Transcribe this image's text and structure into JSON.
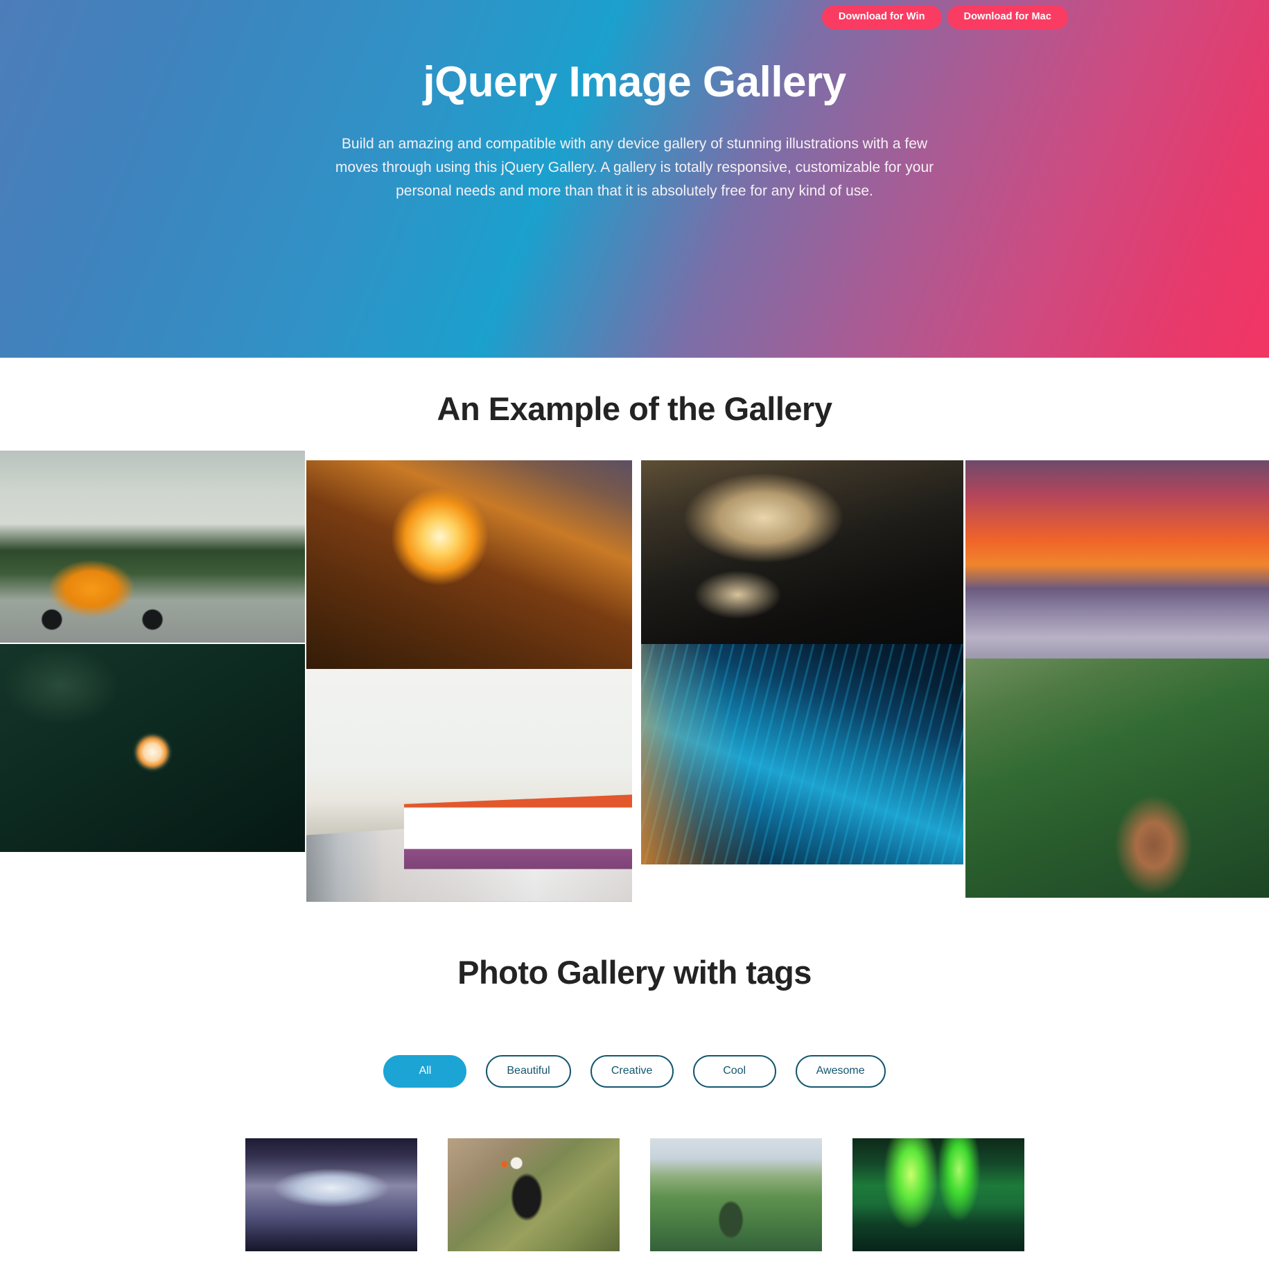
{
  "hero": {
    "buttons": [
      {
        "label": "Download for Win",
        "name": "download-win-button"
      },
      {
        "label": "Download for Mac",
        "name": "download-mac-button"
      }
    ],
    "title": "jQuery Image Gallery",
    "subtitle": "Build an amazing and compatible with any device gallery of stunning illustrations with a few moves through using this jQuery Gallery. A gallery is totally responsive, customizable for your personal needs and more than that it is absolutely free for any kind of use.",
    "colors": {
      "gradient_start": "#4d7dba",
      "gradient_mid": "#1ba0cd",
      "gradient_end": "#f23563",
      "button_bg": "#fa3c63",
      "text": "#ffffff"
    }
  },
  "gallery_section": {
    "heading": "An Example of the Gallery",
    "images": [
      {
        "caption": "Orange vintage car parked by a modern building",
        "art": "a-car"
      },
      {
        "caption": "Sunrise over a forested mountain valley",
        "art": "a-sunset-mtn"
      },
      {
        "caption": "Dark storm clouds at dusk",
        "art": "a-storm"
      },
      {
        "caption": "Red sunset above a sea of fog and mountains",
        "art": "a-fog-sunset"
      },
      {
        "caption": "White and orange rose with dew on dark leaves",
        "art": "a-rose"
      },
      {
        "caption": "Row of city transit buses at a depot",
        "art": "a-bus"
      },
      {
        "caption": "Aerial night view of an illuminated coastal city",
        "art": "a-city"
      },
      {
        "caption": "Green mountain ridge with a winding river",
        "art": "a-green-mtn"
      }
    ]
  },
  "tags_section": {
    "heading": "Photo Gallery with tags",
    "tags": [
      {
        "label": "All",
        "active": true
      },
      {
        "label": "Beautiful",
        "active": false
      },
      {
        "label": "Creative",
        "active": false
      },
      {
        "label": "Cool",
        "active": false
      },
      {
        "label": "Awesome",
        "active": false
      }
    ],
    "colors": {
      "active_bg": "#1ca4d4",
      "border": "#13566e",
      "text": "#13566e"
    },
    "thumbnails": [
      {
        "caption": "Snowy mountain valley at dusk",
        "art": "a-yosemite"
      },
      {
        "caption": "Puffin standing among wildflowers on a cliff",
        "art": "a-puffin"
      },
      {
        "caption": "Hiker walking a green ridge trail",
        "art": "a-hiker"
      },
      {
        "caption": "Green aurora borealis over a lake",
        "art": "a-aurora"
      }
    ]
  }
}
